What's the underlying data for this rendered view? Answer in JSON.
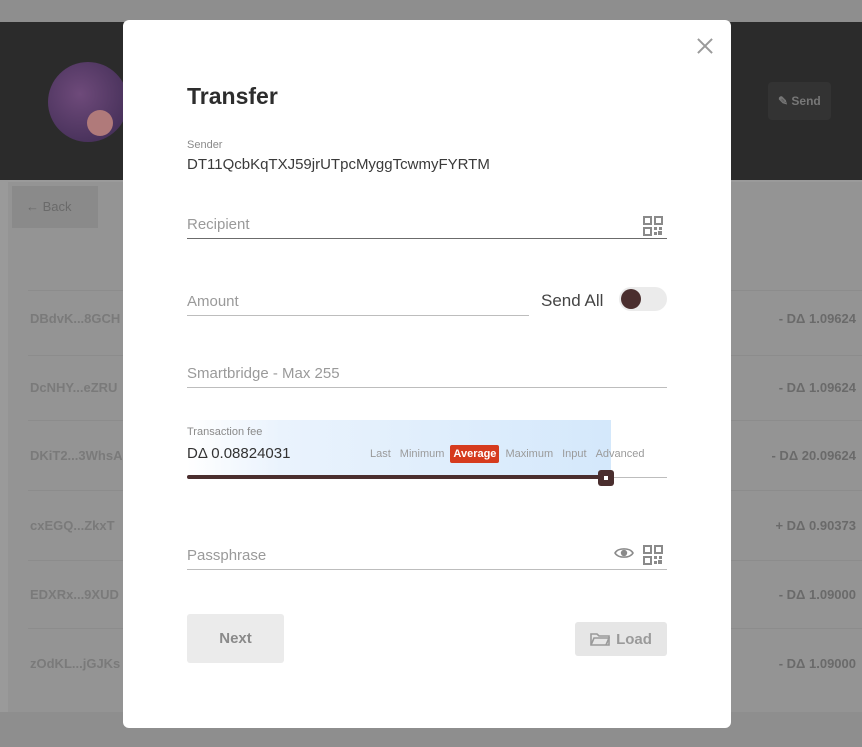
{
  "background": {
    "header_buttons": [
      "Send"
    ],
    "back_label": "Back",
    "amount_rows": [
      "- DΔ 1.09624",
      "- DΔ 1.09624",
      "- DΔ 20.09624",
      "+ DΔ 0.90373",
      "- DΔ 1.09000",
      "- DΔ 1.09000"
    ],
    "address_rows": [
      "DBdvK...8GCH",
      "DcNHY...eZRU",
      "DKiT2...3WhsA",
      "cxEGQ...ZkxT",
      "EDXRx...9XUD",
      "zOdKL...jGJKs"
    ]
  },
  "modal": {
    "title": "Transfer",
    "sender_label": "Sender",
    "sender_address": "DT11QcbKqTXJ59jrUTpcMyggTcwmyFYRTM",
    "recipient_placeholder": "Recipient",
    "amount_placeholder": "Amount",
    "send_all_label": "Send All",
    "smartbridge_placeholder": "Smartbridge - Max 255",
    "fee": {
      "label": "Transaction fee",
      "value": "DΔ 0.08824031",
      "options": [
        "Last",
        "Minimum",
        "Average",
        "Maximum",
        "Input",
        "Advanced"
      ],
      "selected": "Average",
      "slider_fraction": 0.997
    },
    "passphrase_placeholder": "Passphrase",
    "next_label": "Next",
    "load_label": "Load"
  },
  "colors": {
    "accent": "#d63b1e",
    "brand_dark": "#4a2e2e",
    "modal_bg": "#ffffff",
    "overlay": "#9a9a9a"
  },
  "icons": [
    "close-icon",
    "qr-code-icon",
    "eye-icon",
    "folder-icon"
  ]
}
